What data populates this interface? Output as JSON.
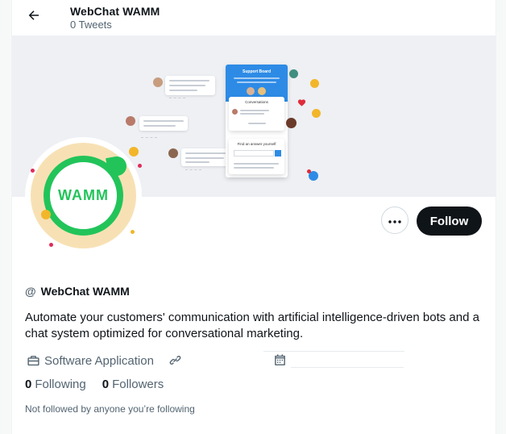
{
  "header": {
    "title": "WebChat WAMM",
    "tweets": "0 Tweets"
  },
  "banner": {
    "widget_title": "Support Board",
    "conversations": "Conversations",
    "find_answer": "Find an answer yourself"
  },
  "avatar": {
    "text": "WAMM",
    "ring_color": "#f7e1b4",
    "brand_color": "#22c45a"
  },
  "actions": {
    "more_label": "More",
    "follow_label": "Follow"
  },
  "profile": {
    "at_symbol": "@",
    "display_name": "WebChat WAMM",
    "bio": "Automate your customers' communication with artificial intelligence-driven bots and a chat system optimized for conversational marketing.",
    "category": "Software Application",
    "following_count": "0",
    "following_label": "Following",
    "followers_count": "0",
    "followers_label": "Followers",
    "followed_note": "Not followed by anyone you’re following"
  },
  "icons": {
    "back": "arrow-left-icon",
    "more": "ellipsis-icon",
    "category": "briefcase-icon",
    "link": "link-icon",
    "joined": "calendar-icon"
  }
}
